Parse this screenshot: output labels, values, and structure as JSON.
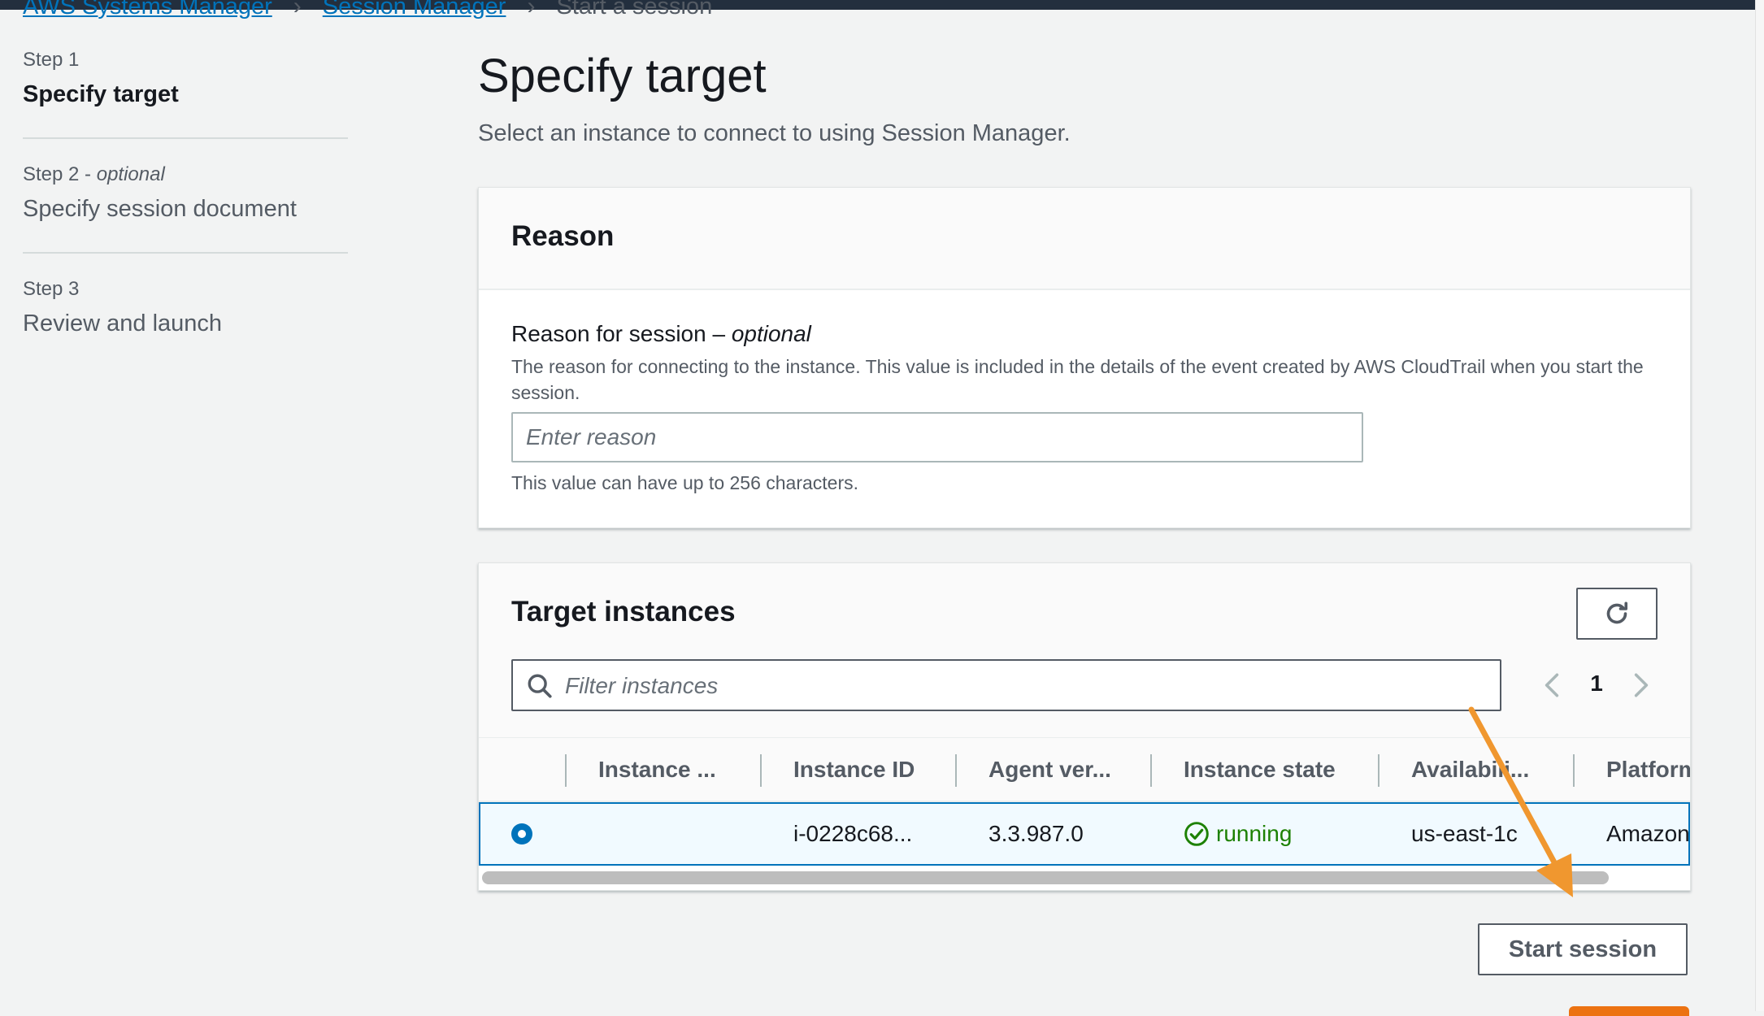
{
  "breadcrumbs": [
    {
      "label": "AWS Systems Manager"
    },
    {
      "label": "Session Manager"
    },
    {
      "label": "Start a session"
    }
  ],
  "steps": [
    {
      "number": "Step 1",
      "title": "Specify target"
    },
    {
      "number": "Step 2 - ",
      "number_suffix": "optional",
      "title": "Specify session document"
    },
    {
      "number": "Step 3",
      "title": "Review and launch"
    }
  ],
  "page": {
    "title": "Specify target",
    "description": "Select an instance to connect to using Session Manager."
  },
  "reason_panel": {
    "title": "Reason",
    "label": "Reason for session – ",
    "label_suffix": "optional",
    "description": "The reason for connecting to the instance. This value is included in the details of the event created by AWS CloudTrail when you start the session.",
    "placeholder": "Enter reason",
    "constraint": "This value can have up to 256 characters."
  },
  "targets_panel": {
    "title": "Target instances",
    "filter_placeholder": "Filter instances",
    "current_page": "1",
    "columns": [
      "Instance ...",
      "Instance ID",
      "Agent ver...",
      "Instance state",
      "Availabili...",
      "Platform"
    ],
    "rows": [
      {
        "selected": true,
        "instance_name": "",
        "instance_id": "i-0228c68...",
        "agent_version": "3.3.987.0",
        "state": "running",
        "availability_zone": "us-east-1c",
        "platform": "Amazon"
      }
    ],
    "scroll_fraction_visible": 0.93
  },
  "actions": {
    "start_session": "Start session"
  },
  "colors": {
    "link": "#0073bb",
    "running": "#1d8102",
    "annotation_arrow": "#f0972f",
    "primary_button": "#ec7211",
    "topbar": "#232f3e"
  }
}
